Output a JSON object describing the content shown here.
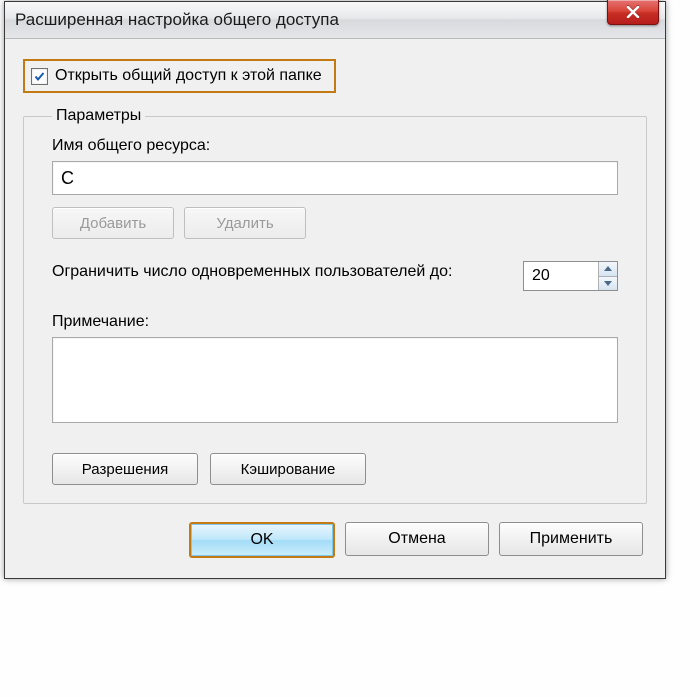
{
  "window": {
    "title": "Расширенная настройка общего доступа",
    "close_icon": "close"
  },
  "share": {
    "checkbox_label": "Открыть общий доступ к этой папке",
    "checked": true
  },
  "params": {
    "legend": "Параметры",
    "share_name_label": "Имя общего ресурса:",
    "share_name_value": "C",
    "add_label": "Добавить",
    "remove_label": "Удалить",
    "limit_label": "Ограничить число одновременных пользователей до:",
    "limit_value": "20",
    "note_label": "Примечание:",
    "note_value": "",
    "permissions_label": "Разрешения",
    "caching_label": "Кэширование"
  },
  "footer": {
    "ok": "OK",
    "cancel": "Отмена",
    "apply": "Применить"
  }
}
